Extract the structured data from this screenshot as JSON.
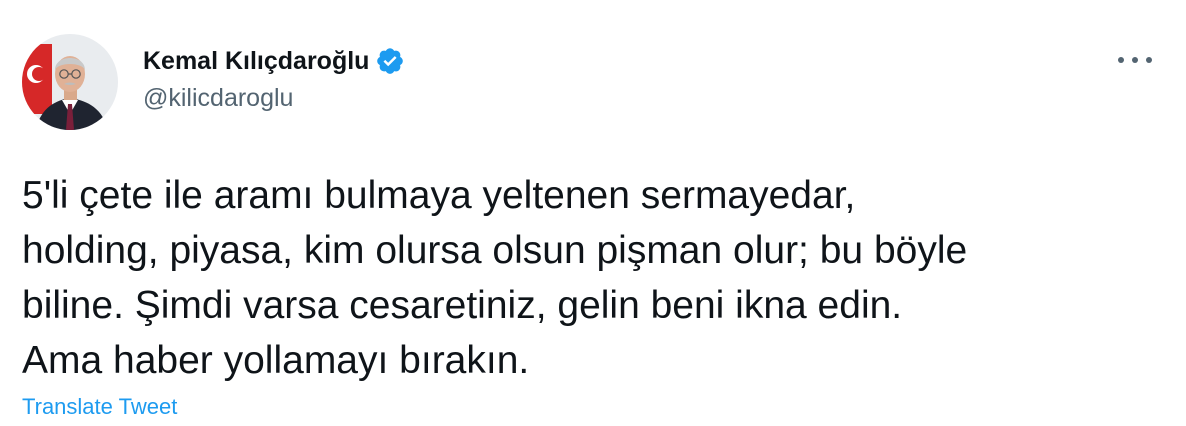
{
  "author": {
    "display_name": "Kemal Kılıçdaroğlu",
    "handle": "@kilicdaroglu",
    "verified": true,
    "verified_icon": "verified-badge-icon",
    "avatar_icon": "profile-photo"
  },
  "menu": {
    "icon": "more-options-icon"
  },
  "tweet": {
    "lines": [
      "5'li çete ile aramı bulmaya yeltenen sermayedar,",
      "holding, piyasa, kim olursa olsun pişman olur; bu böyle",
      "biline. Şimdi varsa cesaretiniz, gelin beni ikna edin.",
      "Ama haber yollamayı bırakın."
    ],
    "translate_label": "Translate Tweet"
  },
  "colors": {
    "text": "#0f1419",
    "secondary": "#536471",
    "accent": "#1d9bf0",
    "background": "#ffffff"
  }
}
